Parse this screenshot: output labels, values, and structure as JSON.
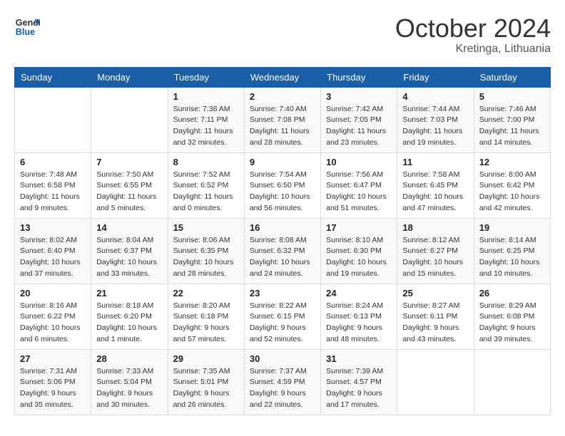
{
  "header": {
    "logo_line1": "General",
    "logo_line2": "Blue",
    "month_title": "October 2024",
    "location": "Kretinga, Lithuania"
  },
  "weekdays": [
    "Sunday",
    "Monday",
    "Tuesday",
    "Wednesday",
    "Thursday",
    "Friday",
    "Saturday"
  ],
  "weeks": [
    [
      {
        "day": null
      },
      {
        "day": null
      },
      {
        "day": "1",
        "sunrise": "7:38 AM",
        "sunset": "7:11 PM",
        "daylight": "11 hours and 32 minutes."
      },
      {
        "day": "2",
        "sunrise": "7:40 AM",
        "sunset": "7:08 PM",
        "daylight": "11 hours and 28 minutes."
      },
      {
        "day": "3",
        "sunrise": "7:42 AM",
        "sunset": "7:05 PM",
        "daylight": "11 hours and 23 minutes."
      },
      {
        "day": "4",
        "sunrise": "7:44 AM",
        "sunset": "7:03 PM",
        "daylight": "11 hours and 19 minutes."
      },
      {
        "day": "5",
        "sunrise": "7:46 AM",
        "sunset": "7:00 PM",
        "daylight": "11 hours and 14 minutes."
      }
    ],
    [
      {
        "day": "6",
        "sunrise": "7:48 AM",
        "sunset": "6:58 PM",
        "daylight": "11 hours and 9 minutes."
      },
      {
        "day": "7",
        "sunrise": "7:50 AM",
        "sunset": "6:55 PM",
        "daylight": "11 hours and 5 minutes."
      },
      {
        "day": "8",
        "sunrise": "7:52 AM",
        "sunset": "6:52 PM",
        "daylight": "11 hours and 0 minutes."
      },
      {
        "day": "9",
        "sunrise": "7:54 AM",
        "sunset": "6:50 PM",
        "daylight": "10 hours and 56 minutes."
      },
      {
        "day": "10",
        "sunrise": "7:56 AM",
        "sunset": "6:47 PM",
        "daylight": "10 hours and 51 minutes."
      },
      {
        "day": "11",
        "sunrise": "7:58 AM",
        "sunset": "6:45 PM",
        "daylight": "10 hours and 47 minutes."
      },
      {
        "day": "12",
        "sunrise": "8:00 AM",
        "sunset": "6:42 PM",
        "daylight": "10 hours and 42 minutes."
      }
    ],
    [
      {
        "day": "13",
        "sunrise": "8:02 AM",
        "sunset": "6:40 PM",
        "daylight": "10 hours and 37 minutes."
      },
      {
        "day": "14",
        "sunrise": "8:04 AM",
        "sunset": "6:37 PM",
        "daylight": "10 hours and 33 minutes."
      },
      {
        "day": "15",
        "sunrise": "8:06 AM",
        "sunset": "6:35 PM",
        "daylight": "10 hours and 28 minutes."
      },
      {
        "day": "16",
        "sunrise": "8:08 AM",
        "sunset": "6:32 PM",
        "daylight": "10 hours and 24 minutes."
      },
      {
        "day": "17",
        "sunrise": "8:10 AM",
        "sunset": "6:30 PM",
        "daylight": "10 hours and 19 minutes."
      },
      {
        "day": "18",
        "sunrise": "8:12 AM",
        "sunset": "6:27 PM",
        "daylight": "10 hours and 15 minutes."
      },
      {
        "day": "19",
        "sunrise": "8:14 AM",
        "sunset": "6:25 PM",
        "daylight": "10 hours and 10 minutes."
      }
    ],
    [
      {
        "day": "20",
        "sunrise": "8:16 AM",
        "sunset": "6:22 PM",
        "daylight": "10 hours and 6 minutes."
      },
      {
        "day": "21",
        "sunrise": "8:18 AM",
        "sunset": "6:20 PM",
        "daylight": "10 hours and 1 minute."
      },
      {
        "day": "22",
        "sunrise": "8:20 AM",
        "sunset": "6:18 PM",
        "daylight": "9 hours and 57 minutes."
      },
      {
        "day": "23",
        "sunrise": "8:22 AM",
        "sunset": "6:15 PM",
        "daylight": "9 hours and 52 minutes."
      },
      {
        "day": "24",
        "sunrise": "8:24 AM",
        "sunset": "6:13 PM",
        "daylight": "9 hours and 48 minutes."
      },
      {
        "day": "25",
        "sunrise": "8:27 AM",
        "sunset": "6:11 PM",
        "daylight": "9 hours and 43 minutes."
      },
      {
        "day": "26",
        "sunrise": "8:29 AM",
        "sunset": "6:08 PM",
        "daylight": "9 hours and 39 minutes."
      }
    ],
    [
      {
        "day": "27",
        "sunrise": "7:31 AM",
        "sunset": "5:06 PM",
        "daylight": "9 hours and 35 minutes."
      },
      {
        "day": "28",
        "sunrise": "7:33 AM",
        "sunset": "5:04 PM",
        "daylight": "9 hours and 30 minutes."
      },
      {
        "day": "29",
        "sunrise": "7:35 AM",
        "sunset": "5:01 PM",
        "daylight": "9 hours and 26 minutes."
      },
      {
        "day": "30",
        "sunrise": "7:37 AM",
        "sunset": "4:59 PM",
        "daylight": "9 hours and 22 minutes."
      },
      {
        "day": "31",
        "sunrise": "7:39 AM",
        "sunset": "4:57 PM",
        "daylight": "9 hours and 17 minutes."
      },
      {
        "day": null
      },
      {
        "day": null
      }
    ]
  ]
}
